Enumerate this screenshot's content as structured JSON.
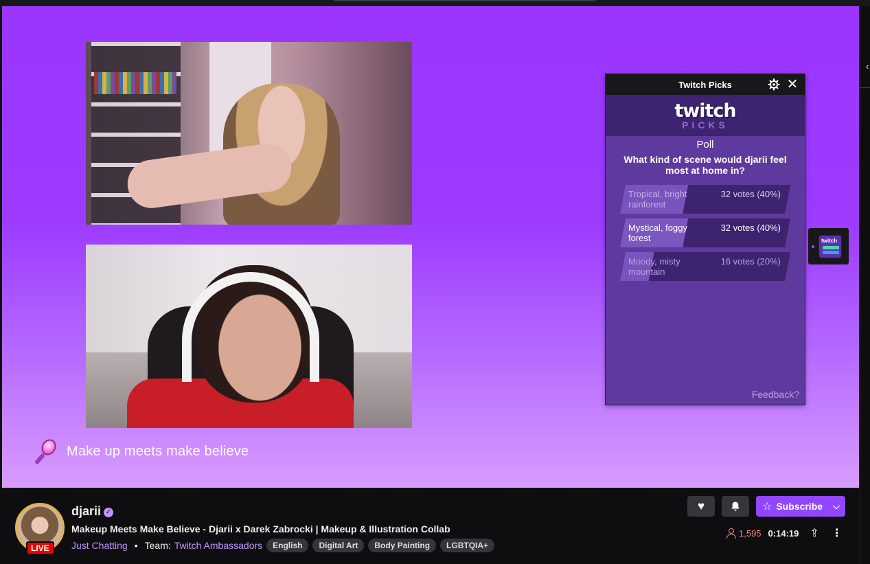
{
  "overlay": {
    "caption": "Make up meets make believe"
  },
  "picks": {
    "header_title": "Twitch Picks",
    "logo_word": "twitch",
    "logo_sub": "PICKS",
    "type_label": "Poll",
    "question": "What kind of scene would djarii feel most at home in?",
    "options": [
      {
        "label": "Tropical, bright rainforest",
        "votes": "32 votes (40%)",
        "fraction": 0.4
      },
      {
        "label": "Mystical, foggy forest",
        "votes": "32 votes (40%)",
        "fraction": 0.4
      },
      {
        "label": "Moody, misty mountain",
        "votes": "16 votes (20%)",
        "fraction": 0.2
      }
    ],
    "feedback_label": "Feedback?"
  },
  "extension": {
    "icon_word": "twitch"
  },
  "channel": {
    "name": "djarii",
    "live_label": "LIVE",
    "title": "Makeup Meets Make Believe - Djarii x Darek Zabrocki | Makeup & Illustration Collab",
    "category": "Just Chatting",
    "team_label": "Team:",
    "team_name": "Twitch Ambassadors",
    "tags": [
      "English",
      "Digital Art",
      "Body Painting",
      "LGBTQIA+"
    ],
    "viewers": "1,595",
    "uptime": "0:14:19"
  },
  "actions": {
    "subscribe_label": "Subscribe"
  },
  "colors": {
    "brand_purple": "#9147ff",
    "live_red": "#eb0400",
    "viewer_red": "#ff8280"
  }
}
